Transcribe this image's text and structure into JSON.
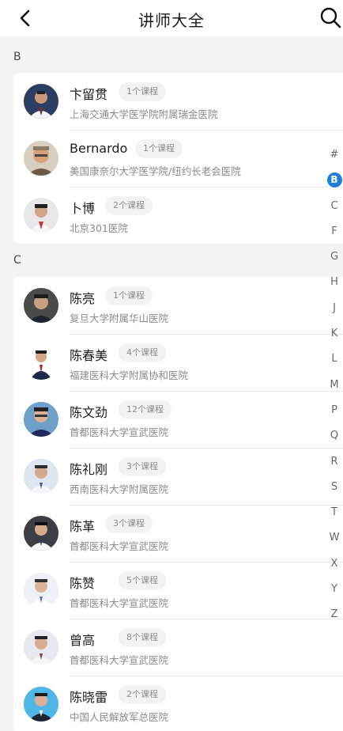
{
  "header": {
    "title": "讲师大全",
    "back_icon": "chevron-left-icon",
    "search_icon": "search-icon"
  },
  "sections": [
    {
      "letter": "B",
      "teachers": [
        {
          "name": "卞留贯",
          "courses": "1个课程",
          "hospital": "上海交通大学医学院附属瑞金医院"
        },
        {
          "name": "Bernardo",
          "courses": "1个课程",
          "hospital": "美国康奈尔大学医学院/纽约长老会医院"
        },
        {
          "name": "卜博",
          "courses": "2个课程",
          "hospital": "北京301医院"
        }
      ]
    },
    {
      "letter": "C",
      "teachers": [
        {
          "name": "陈亮",
          "courses": "1个课程",
          "hospital": "复旦大学附属华山医院"
        },
        {
          "name": "陈春美",
          "courses": "4个课程",
          "hospital": "福建医科大学附属协和医院"
        },
        {
          "name": "陈文劲",
          "courses": "12个课程",
          "hospital": "首都医科大学宣武医院"
        },
        {
          "name": "陈礼刚",
          "courses": "3个课程",
          "hospital": "西南医科大学附属医院"
        },
        {
          "name": "陈革",
          "courses": "3个课程",
          "hospital": "首都医科大学宣武医院"
        },
        {
          "name": "陈赞",
          "courses": "5个课程",
          "hospital": "首都医科大学宣武医院"
        },
        {
          "name": "曾高",
          "courses": "8个课程",
          "hospital": "首都医科大学宣武医院"
        },
        {
          "name": "陈晓雷",
          "courses": "2个课程",
          "hospital": "中国人民解放军总医院"
        }
      ]
    }
  ],
  "index_letters": [
    "#",
    "B",
    "C",
    "F",
    "G",
    "H",
    "J",
    "K",
    "L",
    "M",
    "P",
    "Q",
    "R",
    "S",
    "T",
    "W",
    "X",
    "Y",
    "Z"
  ],
  "active_index": "B",
  "colors": {
    "accent": "#1f7fd6",
    "background": "#f4f4f5",
    "card": "#ffffff",
    "secondary_text": "#8b8b8b"
  }
}
